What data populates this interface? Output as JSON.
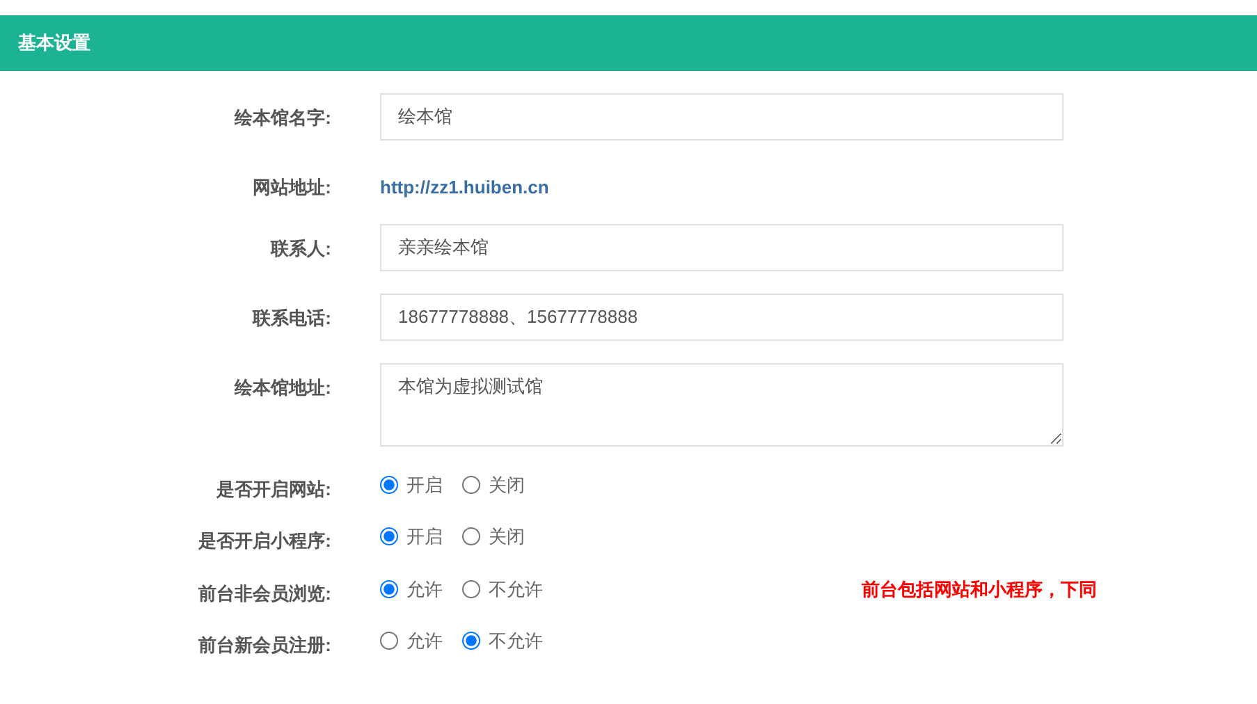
{
  "panel": {
    "title": "基本设置"
  },
  "fields": [
    {
      "kind": "input",
      "label": "绘本馆名字:",
      "value": "绘本馆"
    },
    {
      "kind": "link",
      "label": "网站地址:",
      "value": "http://zz1.huiben.cn"
    },
    {
      "kind": "input",
      "label": "联系人:",
      "value": "亲亲绘本馆"
    },
    {
      "kind": "input",
      "label": "联系电话:",
      "value": "18677778888、15677778888"
    },
    {
      "kind": "textarea",
      "label": "绘本馆地址:",
      "value": "本馆为虚拟测试馆"
    },
    {
      "kind": "radio",
      "label": "是否开启网站:",
      "options": [
        {
          "label": "开启",
          "selected": true
        },
        {
          "label": "关闭",
          "selected": false
        }
      ]
    },
    {
      "kind": "radio",
      "label": "是否开启小程序:",
      "options": [
        {
          "label": "开启",
          "selected": true
        },
        {
          "label": "关闭",
          "selected": false
        }
      ]
    },
    {
      "kind": "radio",
      "label": "前台非会员浏览:",
      "options": [
        {
          "label": "允许",
          "selected": true
        },
        {
          "label": "不允许",
          "selected": false
        }
      ],
      "note": "前台包括网站和小程序，下同"
    },
    {
      "kind": "radio",
      "label": "前台新会员注册:",
      "options": [
        {
          "label": "允许",
          "selected": false
        },
        {
          "label": "不允许",
          "selected": true
        }
      ]
    }
  ]
}
